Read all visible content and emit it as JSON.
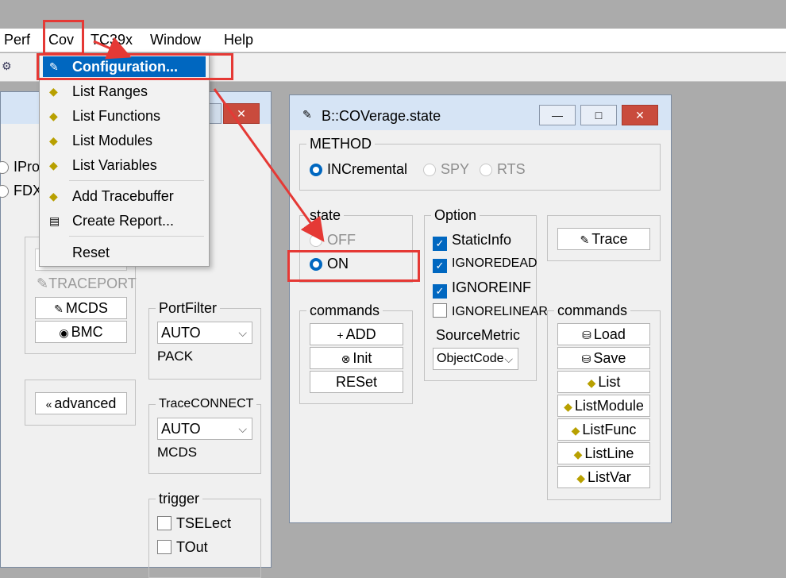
{
  "menubar": {
    "items": [
      {
        "label": "Perf"
      },
      {
        "label": "Cov"
      },
      {
        "label": "TC39x"
      },
      {
        "label": "Window"
      },
      {
        "label": "Help"
      }
    ]
  },
  "dropdown": {
    "items": [
      {
        "label": "Configuration...",
        "icon": "wrench-icon",
        "selected": true
      },
      {
        "label": "List Ranges",
        "icon": "list-icon"
      },
      {
        "label": "List Functions",
        "icon": "list-icon"
      },
      {
        "label": "List Modules",
        "icon": "list-icon"
      },
      {
        "label": "List Variables",
        "icon": "list-icon"
      },
      {
        "label": "Add Tracebuffer",
        "icon": "list-icon"
      },
      {
        "label": "Create Report...",
        "icon": "report-icon"
      },
      {
        "label": "Reset",
        "icon": ""
      }
    ]
  },
  "left_window": {
    "radios": [
      {
        "label": "IPro"
      },
      {
        "label": "FDX"
      }
    ],
    "buttons": {
      "traceport": "TRACEPORT",
      "mcds": "MCDS",
      "bmc": "BMC",
      "advanced": "advanced"
    },
    "portfilter": {
      "label": "PortFilter",
      "value": "AUTO",
      "extra": "PACK"
    },
    "traceconnect": {
      "label": "TraceCONNECT",
      "value": "AUTO",
      "extra": "MCDS"
    },
    "trigger": {
      "label": "trigger",
      "checks": [
        {
          "label": "TSELect"
        },
        {
          "label": "TOut"
        }
      ]
    }
  },
  "coverage_window": {
    "title": "B::COVerage.state",
    "method": {
      "label": "METHOD",
      "options": [
        {
          "label": "INCremental",
          "selected": true
        },
        {
          "label": "SPY",
          "selected": false
        },
        {
          "label": "RTS",
          "selected": false
        }
      ]
    },
    "state": {
      "label": "state",
      "options": [
        {
          "label": "OFF",
          "selected": false
        },
        {
          "label": "ON",
          "selected": true
        }
      ]
    },
    "option": {
      "label": "Option",
      "checks": [
        {
          "label": "StaticInfo",
          "checked": true
        },
        {
          "label": "IGNOREDEAD",
          "checked": true
        },
        {
          "label": "IGNOREINF",
          "checked": true
        },
        {
          "label": "IGNORELINEAR",
          "checked": false
        }
      ],
      "source_metric_label": "SourceMetric",
      "source_metric_value": "ObjectCode"
    },
    "trace_button": "Trace",
    "commands_left": {
      "label": "commands",
      "buttons": [
        {
          "label": "ADD",
          "icon": "+"
        },
        {
          "label": "Init",
          "icon": "⊗"
        },
        {
          "label": "RESet",
          "icon": ""
        }
      ]
    },
    "commands_right": {
      "label": "commands",
      "buttons": [
        {
          "label": "Load"
        },
        {
          "label": "Save"
        },
        {
          "label": "List"
        },
        {
          "label": "ListModule"
        },
        {
          "label": "ListFunc"
        },
        {
          "label": "ListLine"
        },
        {
          "label": "ListVar"
        }
      ]
    },
    "window_buttons": {
      "minimize": "—",
      "maximize": "□",
      "close": "✕"
    }
  },
  "colors": {
    "accent": "#0067c0",
    "annotation": "#e53935",
    "close": "#c94b3d"
  }
}
